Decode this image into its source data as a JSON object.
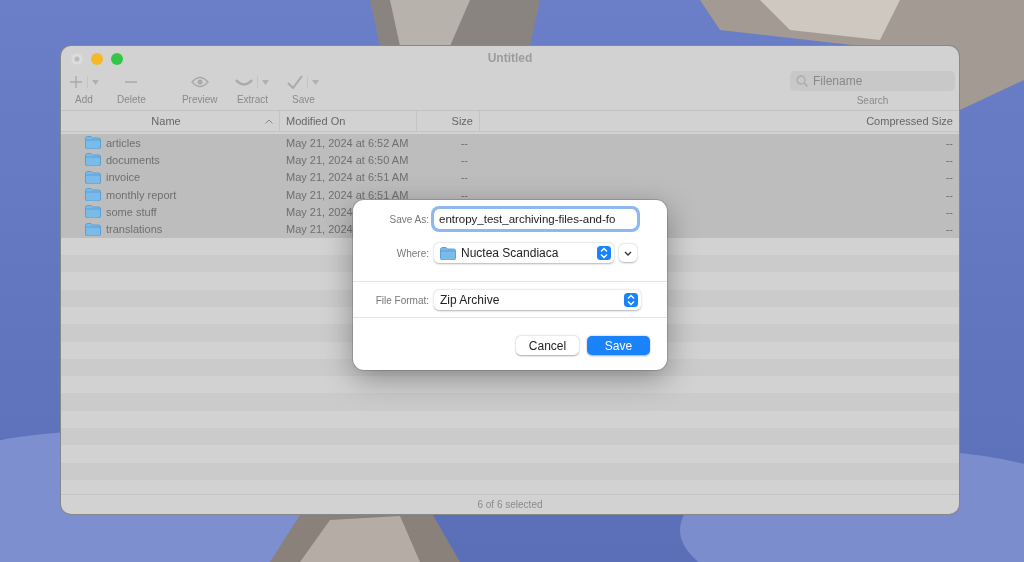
{
  "window": {
    "title": "Untitled"
  },
  "toolbar": {
    "items": [
      {
        "label": "Add",
        "menu": true
      },
      {
        "label": "Delete",
        "menu": false
      },
      {
        "label": "Preview",
        "menu": false
      },
      {
        "label": "Extract",
        "menu": true
      },
      {
        "label": "Save",
        "menu": true
      }
    ],
    "search": {
      "placeholder": "Filename",
      "label": "Search"
    }
  },
  "table": {
    "columns": [
      {
        "label": "Name",
        "sorted": true
      },
      {
        "label": "Modified On",
        "sorted": false
      },
      {
        "label": "Size",
        "sorted": false
      },
      {
        "label": "Compressed Size",
        "sorted": false
      }
    ],
    "rows": [
      {
        "name": "articles",
        "modified": "May 21, 2024 at 6:52 AM",
        "size": "--",
        "compressed_size": "--",
        "selected": true
      },
      {
        "name": "documents",
        "modified": "May 21, 2024 at 6:50 AM",
        "size": "--",
        "compressed_size": "--",
        "selected": true
      },
      {
        "name": "invoice",
        "modified": "May 21, 2024 at 6:51 AM",
        "size": "--",
        "compressed_size": "--",
        "selected": true
      },
      {
        "name": "monthly report",
        "modified": "May 21, 2024 at 6:51 AM",
        "size": "--",
        "compressed_size": "--",
        "selected": true
      },
      {
        "name": "some stuff",
        "modified": "May 21, 2024",
        "compressed_size": "--",
        "selected": true
      },
      {
        "name": "translations",
        "modified": "May 21, 2024",
        "compressed_size": "--",
        "selected": true
      }
    ]
  },
  "status_bar": "6 of 6 selected",
  "dialog": {
    "save_as_label": "Save As:",
    "save_as_value": "entropy_test_archiving-files-and-fo",
    "where_label": "Where:",
    "where_value": "Nuctea Scandiaca",
    "format_label": "File Format:",
    "format_value": "Zip Archive",
    "buttons": [
      {
        "label": "Cancel",
        "default": false
      },
      {
        "label": "Save",
        "default": true
      }
    ]
  }
}
